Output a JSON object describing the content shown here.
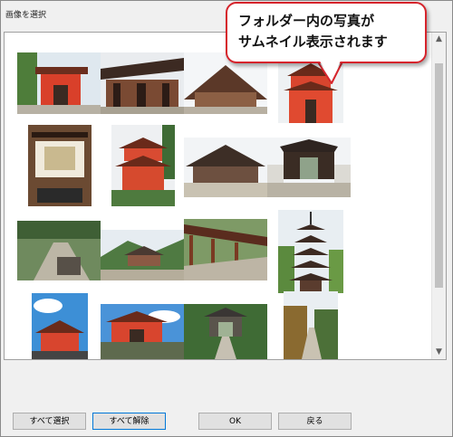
{
  "window": {
    "title": "画像を選択"
  },
  "callout": {
    "line1": "フォルダー内の写真が",
    "line2": "サムネイル表示されます"
  },
  "photos": [
    "shrine-gate-red",
    "shrine-gate-brown",
    "temple-roof",
    "shrine-tower-red",
    "shrine-interior",
    "pagoda-red",
    "temple-hall",
    "temple-gate",
    "stone-path",
    "temple-mountain",
    "corridor",
    "five-story-pagoda",
    "shrine-sky",
    "gate-red-sky",
    "temple-gate-garden",
    "autumn-garden"
  ],
  "buttons": {
    "select_all": "すべて選択",
    "deselect_all": "すべて解除",
    "ok": "OK",
    "back": "戻る"
  }
}
